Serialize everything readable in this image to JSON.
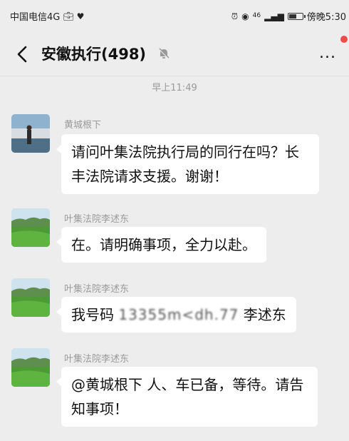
{
  "status_bar": {
    "carrier": "中国电信4G",
    "signal": "46",
    "time": "傍晚5:30"
  },
  "header": {
    "back_icon": "chevron-left-icon",
    "title": "安徽执行(498)",
    "more_label": "...",
    "mute_icon": "bell-off-icon"
  },
  "timestamp": "早上11:49",
  "messages": [
    {
      "sender": "黄城根下",
      "text": "请问叶集法院执行局的同行在吗？长丰法院请求支援。谢谢！"
    },
    {
      "sender": "叶集法院李述东",
      "text": "在。请明确事项，全力以赴。"
    },
    {
      "sender": "叶集法院李述东",
      "text_prefix": "我号码",
      "text_blurred": "13355m<dh.77",
      "text_suffix": "李述东"
    },
    {
      "sender": "叶集法院李述东",
      "text": "@黄城根下  人、车已备，等待。请告知事项！"
    }
  ]
}
